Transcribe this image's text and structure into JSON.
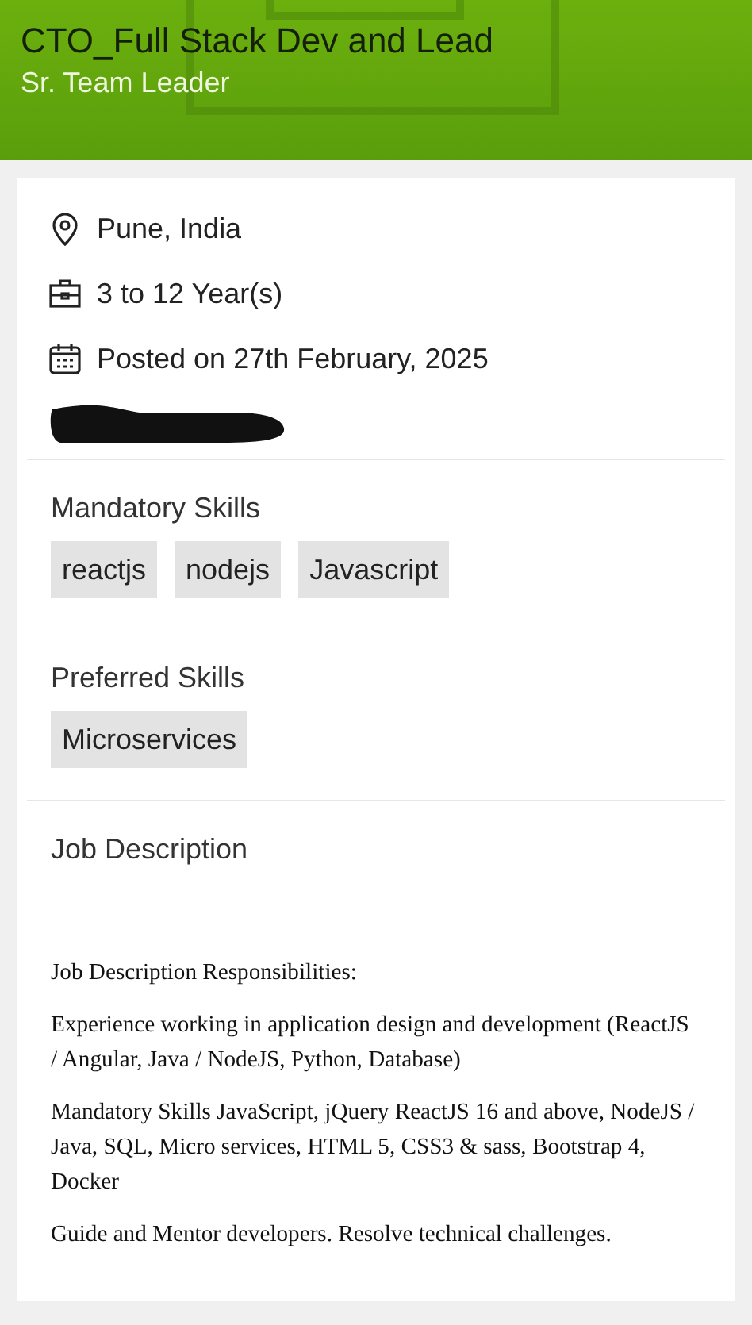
{
  "header": {
    "title": "CTO_Full Stack Dev and Lead",
    "subtitle": "Sr. Team Leader"
  },
  "details": [
    {
      "kind": "location",
      "text": "Pune, India"
    },
    {
      "kind": "experience",
      "text": "3 to 12 Year(s)"
    },
    {
      "kind": "date",
      "text": "Posted on 27th February, 2025"
    },
    {
      "kind": "redacted"
    }
  ],
  "mandatory_skills": {
    "heading": "Mandatory Skills",
    "tags": [
      "reactjs",
      "nodejs",
      "Javascript"
    ]
  },
  "preferred_skills": {
    "heading": "Preferred Skills",
    "tags": [
      "Microservices"
    ]
  },
  "job_description": {
    "heading": "Job Description",
    "paragraphs": [
      "Job Description Responsibilities:",
      "Experience working in application design and development (ReactJS / Angular, Java / NodeJS, Python, Database)",
      "Mandatory Skills JavaScript, jQuery ReactJS 16 and above, NodeJS / Java, SQL, Micro services, HTML 5, CSS3 & sass, Bootstrap 4, Docker",
      "Guide and Mentor developers. Resolve technical challenges."
    ]
  }
}
